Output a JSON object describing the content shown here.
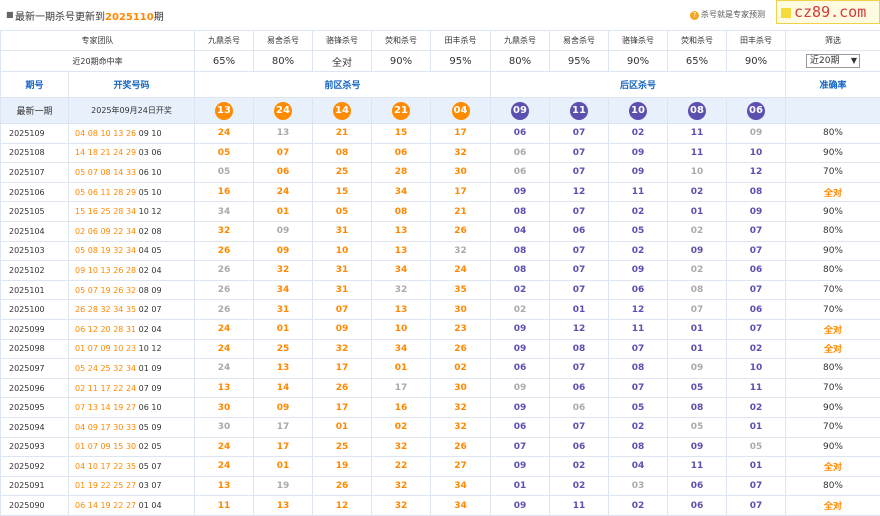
{
  "header": {
    "bullet": "■",
    "update_prefix": "最新一期杀号更新到",
    "update_issue": "2025110",
    "update_suffix": "期",
    "hint": "杀号就是专家预测",
    "logo": "cz89.com"
  },
  "team_row": {
    "label": "专家团队",
    "experts": [
      "九鼎杀号",
      "易舍杀号",
      "骆锋杀号",
      "荧和杀号",
      "田丰杀号",
      "九鼎杀号",
      "易舍杀号",
      "骆锋杀号",
      "荧和杀号",
      "田丰杀号"
    ],
    "extra": "筛选"
  },
  "rate_row": {
    "label": "近20期命中率",
    "rates": [
      "65%",
      "80%",
      "全对",
      "90%",
      "95%",
      "80%",
      "95%",
      "90%",
      "65%",
      "90%"
    ],
    "select_value": "近20期"
  },
  "col_headers": {
    "issue": "期号",
    "draw": "开奖号码",
    "front": "前区杀号",
    "back": "后区杀号",
    "accuracy": "准确率"
  },
  "latest": {
    "label": "最新一期",
    "date": "2025年09月24日开奖",
    "front": [
      "13",
      "24",
      "14",
      "21",
      "04"
    ],
    "back": [
      "09",
      "11",
      "10",
      "08",
      "06"
    ]
  },
  "rows": [
    {
      "issue": "2025109",
      "front_draw": [
        "04",
        "08",
        "10",
        "13",
        "26"
      ],
      "back_draw": [
        "09",
        "10"
      ],
      "front": [
        [
          "24",
          "o"
        ],
        [
          "13",
          "g"
        ],
        [
          "21",
          "o"
        ],
        [
          "15",
          "o"
        ],
        [
          "17",
          "o"
        ]
      ],
      "back": [
        [
          "06",
          "b"
        ],
        [
          "07",
          "b"
        ],
        [
          "02",
          "b"
        ],
        [
          "11",
          "b"
        ],
        [
          "09",
          "g"
        ]
      ],
      "acc": "80%"
    },
    {
      "issue": "2025108",
      "front_draw": [
        "14",
        "18",
        "21",
        "24",
        "29"
      ],
      "back_draw": [
        "03",
        "06"
      ],
      "front": [
        [
          "05",
          "o"
        ],
        [
          "07",
          "o"
        ],
        [
          "08",
          "o"
        ],
        [
          "06",
          "o"
        ],
        [
          "32",
          "o"
        ]
      ],
      "back": [
        [
          "06",
          "g"
        ],
        [
          "07",
          "b"
        ],
        [
          "09",
          "b"
        ],
        [
          "11",
          "b"
        ],
        [
          "10",
          "b"
        ]
      ],
      "acc": "90%"
    },
    {
      "issue": "2025107",
      "front_draw": [
        "05",
        "07",
        "08",
        "14",
        "33"
      ],
      "back_draw": [
        "06",
        "10"
      ],
      "front": [
        [
          "05",
          "g"
        ],
        [
          "06",
          "o"
        ],
        [
          "25",
          "o"
        ],
        [
          "28",
          "o"
        ],
        [
          "30",
          "o"
        ]
      ],
      "back": [
        [
          "06",
          "g"
        ],
        [
          "07",
          "b"
        ],
        [
          "09",
          "b"
        ],
        [
          "10",
          "g"
        ],
        [
          "12",
          "b"
        ]
      ],
      "acc": "70%"
    },
    {
      "issue": "2025106",
      "front_draw": [
        "05",
        "06",
        "11",
        "28",
        "29"
      ],
      "back_draw": [
        "05",
        "10"
      ],
      "front": [
        [
          "16",
          "o"
        ],
        [
          "24",
          "o"
        ],
        [
          "15",
          "o"
        ],
        [
          "34",
          "o"
        ],
        [
          "17",
          "o"
        ]
      ],
      "back": [
        [
          "09",
          "b"
        ],
        [
          "12",
          "b"
        ],
        [
          "11",
          "b"
        ],
        [
          "02",
          "b"
        ],
        [
          "08",
          "b"
        ]
      ],
      "acc": "全对"
    },
    {
      "issue": "2025105",
      "front_draw": [
        "15",
        "16",
        "25",
        "28",
        "34"
      ],
      "back_draw": [
        "10",
        "12"
      ],
      "front": [
        [
          "34",
          "g"
        ],
        [
          "01",
          "o"
        ],
        [
          "05",
          "o"
        ],
        [
          "08",
          "o"
        ],
        [
          "21",
          "o"
        ]
      ],
      "back": [
        [
          "08",
          "b"
        ],
        [
          "07",
          "b"
        ],
        [
          "02",
          "b"
        ],
        [
          "01",
          "b"
        ],
        [
          "09",
          "b"
        ]
      ],
      "acc": "90%"
    },
    {
      "issue": "2025104",
      "front_draw": [
        "02",
        "06",
        "09",
        "22",
        "34"
      ],
      "back_draw": [
        "02",
        "08"
      ],
      "front": [
        [
          "32",
          "o"
        ],
        [
          "09",
          "g"
        ],
        [
          "31",
          "o"
        ],
        [
          "13",
          "o"
        ],
        [
          "26",
          "o"
        ]
      ],
      "back": [
        [
          "04",
          "b"
        ],
        [
          "06",
          "b"
        ],
        [
          "05",
          "b"
        ],
        [
          "02",
          "g"
        ],
        [
          "07",
          "b"
        ]
      ],
      "acc": "80%"
    },
    {
      "issue": "2025103",
      "front_draw": [
        "05",
        "08",
        "19",
        "32",
        "34"
      ],
      "back_draw": [
        "04",
        "05"
      ],
      "front": [
        [
          "26",
          "o"
        ],
        [
          "09",
          "o"
        ],
        [
          "10",
          "o"
        ],
        [
          "13",
          "o"
        ],
        [
          "32",
          "g"
        ]
      ],
      "back": [
        [
          "08",
          "b"
        ],
        [
          "07",
          "b"
        ],
        [
          "02",
          "b"
        ],
        [
          "09",
          "b"
        ],
        [
          "07",
          "b"
        ]
      ],
      "acc": "90%"
    },
    {
      "issue": "2025102",
      "front_draw": [
        "09",
        "10",
        "13",
        "26",
        "28"
      ],
      "back_draw": [
        "02",
        "04"
      ],
      "front": [
        [
          "26",
          "g"
        ],
        [
          "32",
          "o"
        ],
        [
          "31",
          "o"
        ],
        [
          "34",
          "o"
        ],
        [
          "24",
          "o"
        ]
      ],
      "back": [
        [
          "08",
          "b"
        ],
        [
          "07",
          "b"
        ],
        [
          "09",
          "b"
        ],
        [
          "02",
          "g"
        ],
        [
          "06",
          "b"
        ]
      ],
      "acc": "80%"
    },
    {
      "issue": "2025101",
      "front_draw": [
        "05",
        "07",
        "19",
        "26",
        "32"
      ],
      "back_draw": [
        "08",
        "09"
      ],
      "front": [
        [
          "26",
          "g"
        ],
        [
          "34",
          "o"
        ],
        [
          "31",
          "o"
        ],
        [
          "32",
          "g"
        ],
        [
          "35",
          "o"
        ]
      ],
      "back": [
        [
          "02",
          "b"
        ],
        [
          "07",
          "b"
        ],
        [
          "06",
          "b"
        ],
        [
          "08",
          "g"
        ],
        [
          "07",
          "b"
        ]
      ],
      "acc": "70%"
    },
    {
      "issue": "2025100",
      "front_draw": [
        "26",
        "28",
        "32",
        "34",
        "35"
      ],
      "back_draw": [
        "02",
        "07"
      ],
      "front": [
        [
          "26",
          "g"
        ],
        [
          "31",
          "o"
        ],
        [
          "07",
          "o"
        ],
        [
          "13",
          "o"
        ],
        [
          "30",
          "o"
        ]
      ],
      "back": [
        [
          "02",
          "g"
        ],
        [
          "01",
          "b"
        ],
        [
          "12",
          "b"
        ],
        [
          "07",
          "g"
        ],
        [
          "06",
          "b"
        ]
      ],
      "acc": "70%"
    },
    {
      "issue": "2025099",
      "front_draw": [
        "06",
        "12",
        "20",
        "28",
        "31"
      ],
      "back_draw": [
        "02",
        "04"
      ],
      "front": [
        [
          "24",
          "o"
        ],
        [
          "01",
          "o"
        ],
        [
          "09",
          "o"
        ],
        [
          "10",
          "o"
        ],
        [
          "23",
          "o"
        ]
      ],
      "back": [
        [
          "09",
          "b"
        ],
        [
          "12",
          "b"
        ],
        [
          "11",
          "b"
        ],
        [
          "01",
          "b"
        ],
        [
          "07",
          "b"
        ]
      ],
      "acc": "全对"
    },
    {
      "issue": "2025098",
      "front_draw": [
        "01",
        "07",
        "09",
        "10",
        "23"
      ],
      "back_draw": [
        "10",
        "12"
      ],
      "front": [
        [
          "24",
          "o"
        ],
        [
          "25",
          "o"
        ],
        [
          "32",
          "o"
        ],
        [
          "34",
          "o"
        ],
        [
          "26",
          "o"
        ]
      ],
      "back": [
        [
          "09",
          "b"
        ],
        [
          "08",
          "b"
        ],
        [
          "07",
          "b"
        ],
        [
          "01",
          "b"
        ],
        [
          "02",
          "b"
        ]
      ],
      "acc": "全对"
    },
    {
      "issue": "2025097",
      "front_draw": [
        "05",
        "24",
        "25",
        "32",
        "34"
      ],
      "back_draw": [
        "01",
        "09"
      ],
      "front": [
        [
          "24",
          "g"
        ],
        [
          "13",
          "o"
        ],
        [
          "17",
          "o"
        ],
        [
          "01",
          "o"
        ],
        [
          "02",
          "o"
        ]
      ],
      "back": [
        [
          "06",
          "b"
        ],
        [
          "07",
          "b"
        ],
        [
          "08",
          "b"
        ],
        [
          "09",
          "g"
        ],
        [
          "10",
          "b"
        ]
      ],
      "acc": "80%"
    },
    {
      "issue": "2025096",
      "front_draw": [
        "02",
        "11",
        "17",
        "22",
        "24"
      ],
      "back_draw": [
        "07",
        "09"
      ],
      "front": [
        [
          "13",
          "o"
        ],
        [
          "14",
          "o"
        ],
        [
          "26",
          "o"
        ],
        [
          "17",
          "g"
        ],
        [
          "30",
          "o"
        ]
      ],
      "back": [
        [
          "09",
          "g"
        ],
        [
          "06",
          "b"
        ],
        [
          "07",
          "b"
        ],
        [
          "05",
          "b"
        ],
        [
          "11",
          "b"
        ]
      ],
      "acc": "70%"
    },
    {
      "issue": "2025095",
      "front_draw": [
        "07",
        "13",
        "14",
        "19",
        "27"
      ],
      "back_draw": [
        "06",
        "10"
      ],
      "front": [
        [
          "30",
          "o"
        ],
        [
          "09",
          "o"
        ],
        [
          "17",
          "o"
        ],
        [
          "16",
          "o"
        ],
        [
          "32",
          "o"
        ]
      ],
      "back": [
        [
          "09",
          "b"
        ],
        [
          "06",
          "g"
        ],
        [
          "05",
          "b"
        ],
        [
          "08",
          "b"
        ],
        [
          "02",
          "b"
        ]
      ],
      "acc": "90%"
    },
    {
      "issue": "2025094",
      "front_draw": [
        "04",
        "09",
        "17",
        "30",
        "33"
      ],
      "back_draw": [
        "05",
        "09"
      ],
      "front": [
        [
          "30",
          "g"
        ],
        [
          "17",
          "g"
        ],
        [
          "01",
          "o"
        ],
        [
          "02",
          "o"
        ],
        [
          "32",
          "o"
        ]
      ],
      "back": [
        [
          "06",
          "b"
        ],
        [
          "07",
          "b"
        ],
        [
          "02",
          "b"
        ],
        [
          "05",
          "g"
        ],
        [
          "01",
          "b"
        ]
      ],
      "acc": "70%"
    },
    {
      "issue": "2025093",
      "front_draw": [
        "01",
        "07",
        "09",
        "15",
        "30"
      ],
      "back_draw": [
        "02",
        "05"
      ],
      "front": [
        [
          "24",
          "o"
        ],
        [
          "17",
          "o"
        ],
        [
          "25",
          "o"
        ],
        [
          "32",
          "o"
        ],
        [
          "26",
          "o"
        ]
      ],
      "back": [
        [
          "07",
          "b"
        ],
        [
          "06",
          "b"
        ],
        [
          "08",
          "b"
        ],
        [
          "09",
          "b"
        ],
        [
          "05",
          "g"
        ]
      ],
      "acc": "90%"
    },
    {
      "issue": "2025092",
      "front_draw": [
        "04",
        "10",
        "17",
        "22",
        "35"
      ],
      "back_draw": [
        "05",
        "07"
      ],
      "front": [
        [
          "24",
          "o"
        ],
        [
          "01",
          "o"
        ],
        [
          "19",
          "o"
        ],
        [
          "22",
          "o"
        ],
        [
          "27",
          "o"
        ]
      ],
      "back": [
        [
          "09",
          "b"
        ],
        [
          "02",
          "b"
        ],
        [
          "04",
          "b"
        ],
        [
          "11",
          "b"
        ],
        [
          "01",
          "b"
        ]
      ],
      "acc": "全对"
    },
    {
      "issue": "2025091",
      "front_draw": [
        "01",
        "19",
        "22",
        "25",
        "27"
      ],
      "back_draw": [
        "03",
        "07"
      ],
      "front": [
        [
          "13",
          "o"
        ],
        [
          "19",
          "g"
        ],
        [
          "26",
          "o"
        ],
        [
          "32",
          "o"
        ],
        [
          "34",
          "o"
        ]
      ],
      "back": [
        [
          "01",
          "b"
        ],
        [
          "02",
          "b"
        ],
        [
          "03",
          "g"
        ],
        [
          "06",
          "b"
        ],
        [
          "07",
          "b"
        ]
      ],
      "acc": "80%"
    },
    {
      "issue": "2025090",
      "front_draw": [
        "06",
        "14",
        "19",
        "22",
        "27"
      ],
      "back_draw": [
        "01",
        "04"
      ],
      "front": [
        [
          "11",
          "o"
        ],
        [
          "13",
          "o"
        ],
        [
          "12",
          "o"
        ],
        [
          "32",
          "o"
        ],
        [
          "34",
          "o"
        ]
      ],
      "back": [
        [
          "09",
          "b"
        ],
        [
          "11",
          "b"
        ],
        [
          "02",
          "b"
        ],
        [
          "06",
          "b"
        ],
        [
          "07",
          "b"
        ]
      ],
      "acc": "全对"
    }
  ],
  "colors": {
    "front_hit": "#ff8800",
    "miss": "#aaaaaa",
    "back_hit": "#5b4fb0",
    "header_blue": "#1565c0",
    "latest_bg": "#e8f1fb"
  }
}
